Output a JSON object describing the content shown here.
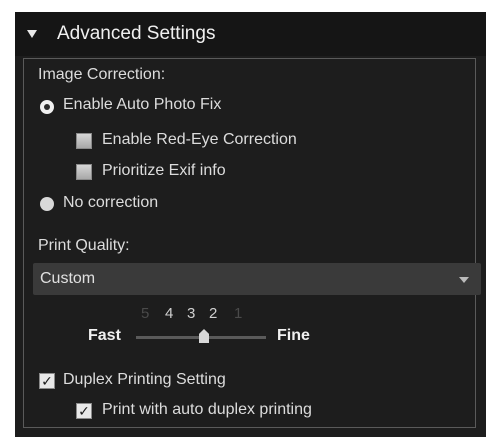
{
  "header": {
    "title": "Advanced Settings"
  },
  "image_correction": {
    "label": "Image Correction:",
    "enable_auto_fix": {
      "label": "Enable Auto Photo Fix",
      "selected": true
    },
    "red_eye": {
      "label": "Enable Red-Eye Correction",
      "checked": false
    },
    "exif": {
      "label": "Prioritize Exif info",
      "checked": false
    },
    "no_correction": {
      "label": "No correction",
      "selected": false
    }
  },
  "print_quality": {
    "label": "Print Quality:",
    "selected": "Custom",
    "slider": {
      "ticks": [
        "5",
        "4",
        "3",
        "2",
        "1"
      ],
      "value": 3,
      "left_label": "Fast",
      "right_label": "Fine"
    }
  },
  "duplex": {
    "label": "Duplex Printing Setting",
    "checked": true,
    "auto": {
      "label": "Print with auto duplex printing",
      "checked": true
    }
  },
  "colors": {
    "panel_bg": "#1d1d1d",
    "header_bg": "#151515",
    "select_bg": "#3a3a3a",
    "text": "#dcdcdc"
  }
}
